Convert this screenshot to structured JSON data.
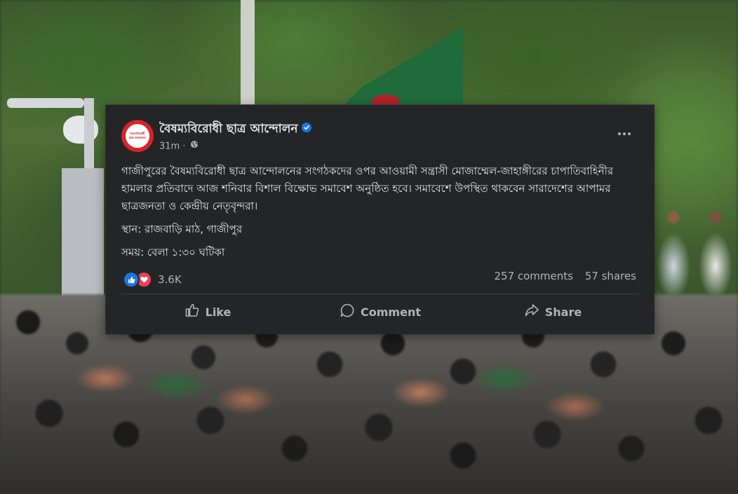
{
  "post": {
    "page_name": "বৈষম্যবিরোধী ছাত্র আন্দোলন",
    "time": "31m",
    "separator": "·",
    "avatar_text": [
      "বৈষম্যবিরোধী",
      "ছাত্র আন্দোলন"
    ],
    "body_lines": [
      "গাজীপুরের বৈষম্যবিরোধী ছাত্র আন্দোলনের সংগঠকদের ওপর আওয়ামী সন্ত্রাসী মোজাম্মেল-জাহাঙ্গীরের চাপাতিবাহিনীর হামলার প্রতিবাদে আজ শনিবার বিশাল বিক্ষোভ সমাবেশ অনুষ্ঠিত হবে। সমাবেশে উপস্থিত থাকবেন সারাদেশের আপামর ছাত্রজনতা ও কেন্দ্রীয় নেতৃবৃন্দরা।",
      "স্থান: রাজবাড়ি মাঠ, গাজীপুর",
      "সময়: বেলা ১:৩০ ঘটিকা"
    ],
    "reactions_count": "3.6K",
    "comments": "257 comments",
    "shares": "57 shares",
    "actions": {
      "like": "Like",
      "comment": "Comment",
      "share": "Share"
    }
  },
  "colors": {
    "card_bg": "#242526",
    "text_primary": "#e4e6eb",
    "text_secondary": "#b0b3b8",
    "verified": "#1b74e4",
    "like": "#1b74e4",
    "love": "#f33e58",
    "avatar_red": "#d8232a"
  },
  "icons": [
    "verified-badge-icon",
    "globe-icon",
    "more-options-icon",
    "like-reaction-icon",
    "love-reaction-icon",
    "thumbs-up-icon",
    "comment-bubble-icon",
    "share-arrow-icon"
  ]
}
